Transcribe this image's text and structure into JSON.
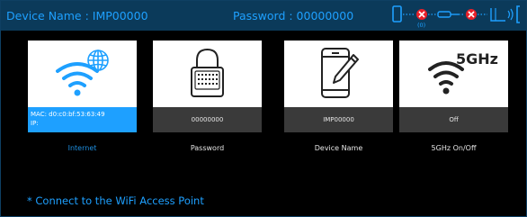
{
  "header": {
    "device_name": "Device Name : IMP00000",
    "password": "Password : 00000000",
    "connection_error_count": "(0)"
  },
  "cards": [
    {
      "id": "internet",
      "icon": "wifi-globe-icon",
      "label": "Internet",
      "mac": "MAC:  d0:c0:bf:53:63:49",
      "ip": "IP:",
      "active": true
    },
    {
      "id": "password",
      "icon": "padlock-icon",
      "label": "Password",
      "value": "00000000"
    },
    {
      "id": "device-name",
      "icon": "phone-edit-icon",
      "label": "Device Name",
      "value": "IMP00000"
    },
    {
      "id": "5ghz",
      "icon": "wifi-5ghz-icon",
      "label": "5GHz On/Off",
      "value": "Off",
      "icon_text": "5GHz"
    }
  ],
  "footer": {
    "note": "* Connect to the WiFi Access Point"
  },
  "colors": {
    "accent": "#1ea0ff",
    "titlebar": "#0b3a5a",
    "card_value_bg": "#3a3a3a",
    "error": "#e8202a"
  }
}
